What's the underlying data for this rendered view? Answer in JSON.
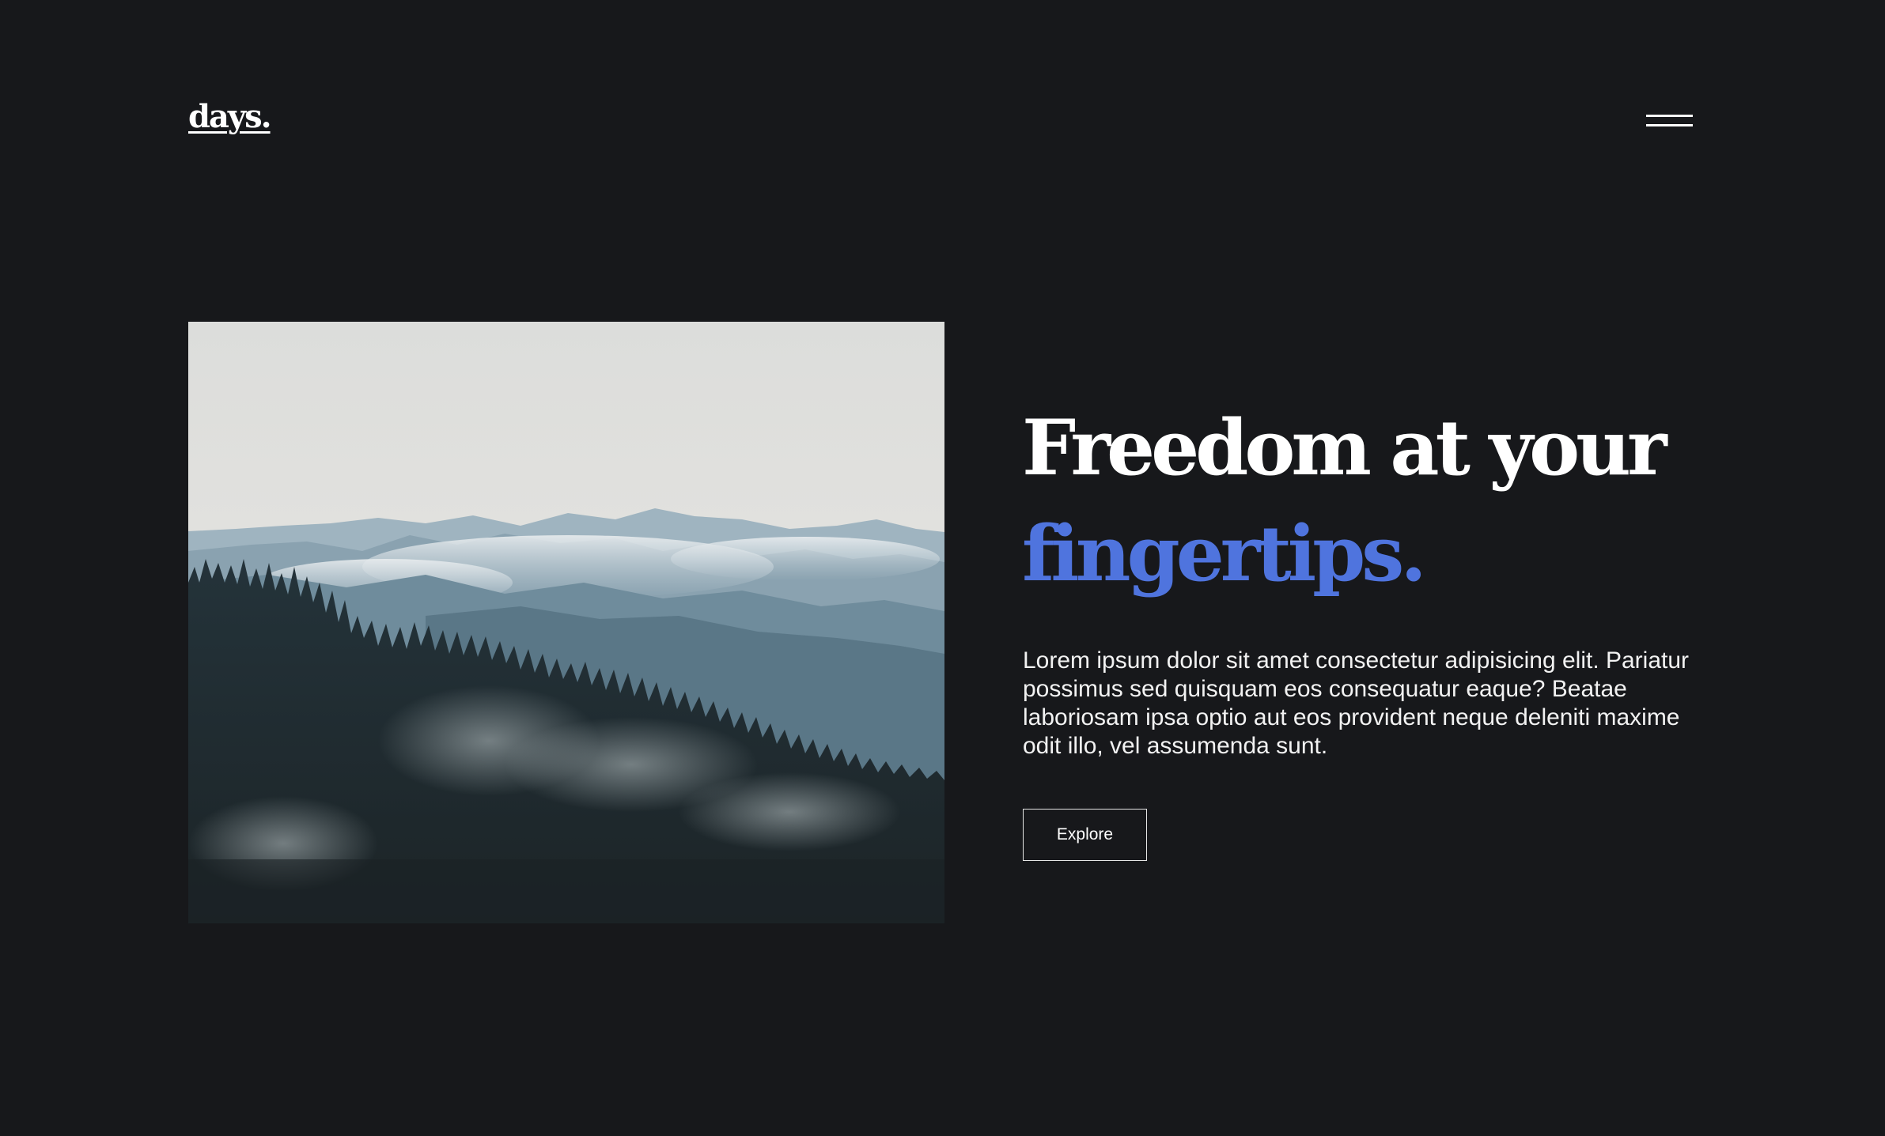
{
  "header": {
    "logo_text": "days.",
    "menu_icon": "hamburger-menu-icon"
  },
  "hero": {
    "image": "misty-mountain-forest-photo",
    "headline_line1": "Freedom at your",
    "headline_line2": "fingertips.",
    "description": "Lorem ipsum dolor sit amet consectetur adipisicing elit. Pariatur possimus sed quisquam eos consequatur eaque? Beatae laboriosam ipsa optio aut eos provident neque deleniti maxime odit illo, vel assumenda sunt.",
    "cta_label": "Explore"
  },
  "colors": {
    "background": "#17181b",
    "text": "#ffffff",
    "accent": "#4f74de"
  }
}
